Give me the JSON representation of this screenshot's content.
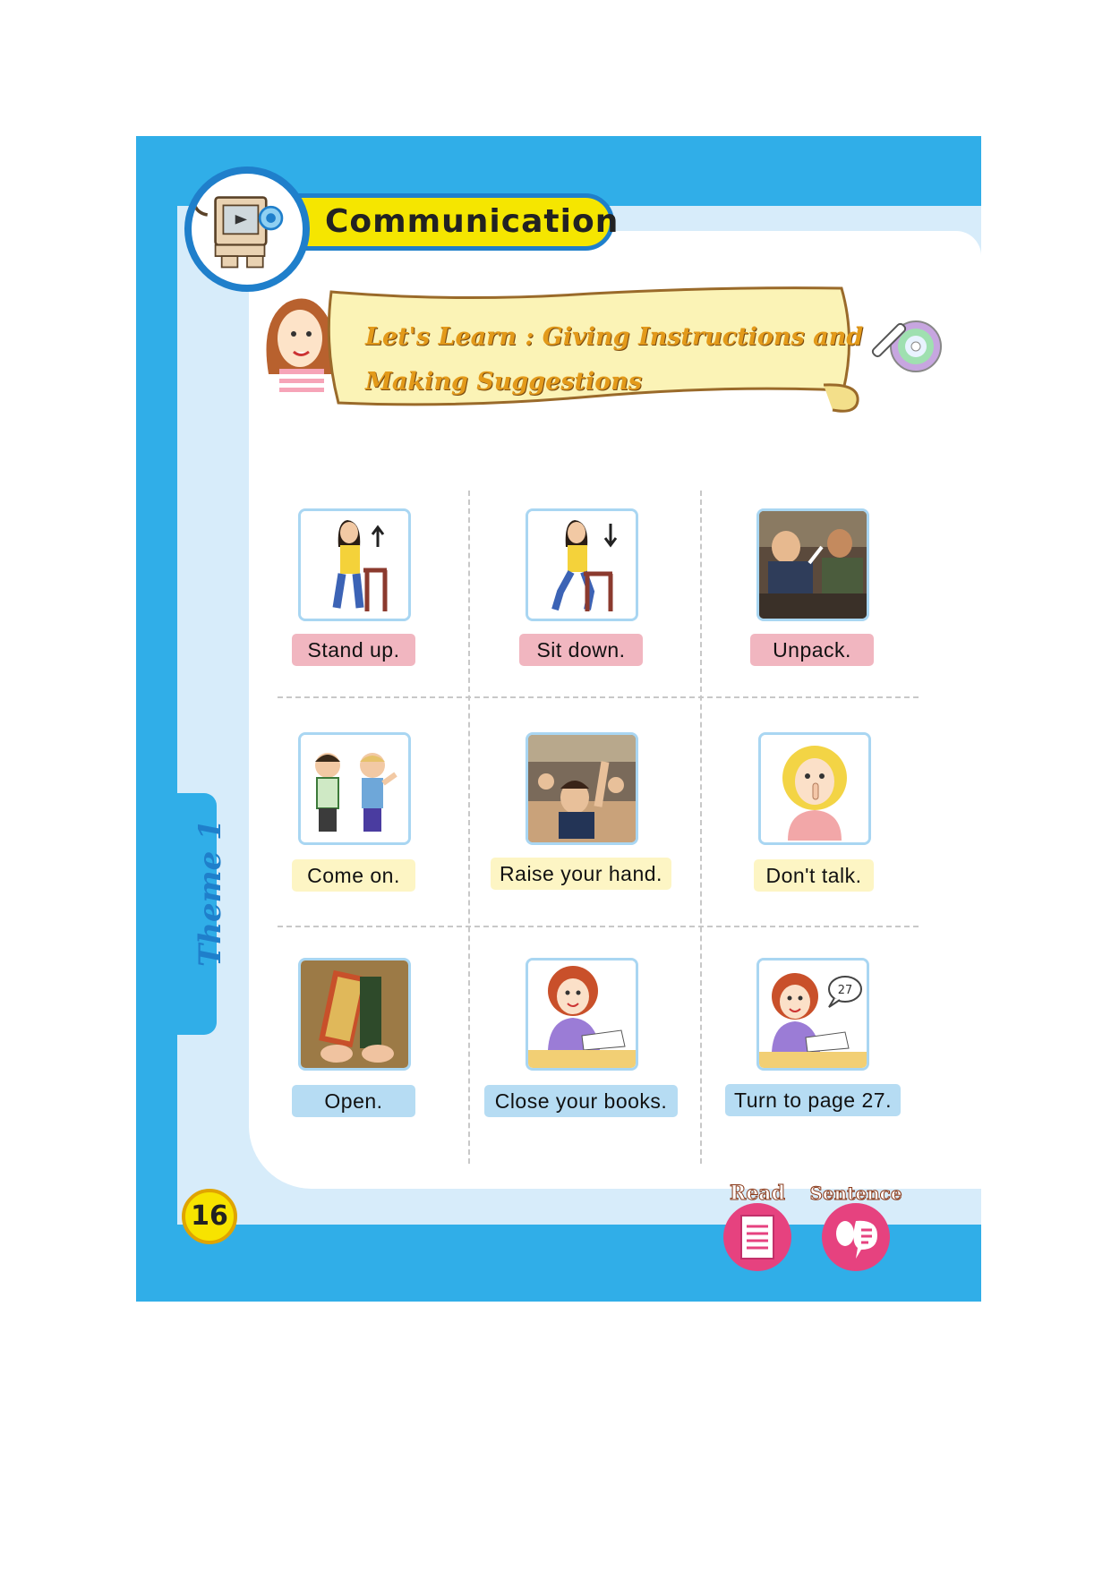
{
  "header": {
    "title": "Communication"
  },
  "banner": {
    "line1": "Let's Learn : Giving Instructions and",
    "line2": "Making Suggestions"
  },
  "side_tab": {
    "label": "Theme 1"
  },
  "page_number": "16",
  "items": [
    {
      "caption": "Stand up.",
      "color": "#f1b6c0",
      "icon": "girl-standing-up-picture"
    },
    {
      "caption": "Sit down.",
      "color": "#f1b6c0",
      "icon": "girl-sitting-down-picture"
    },
    {
      "caption": "Unpack.",
      "color": "#f1b6c0",
      "icon": "classroom-unpack-photo"
    },
    {
      "caption": "Come on.",
      "color": "#fdf5c4",
      "icon": "two-boys-picture"
    },
    {
      "caption": "Raise your hand.",
      "color": "#fdf5c4",
      "icon": "raise-hand-photo"
    },
    {
      "caption": "Don't talk.",
      "color": "#fdf5c4",
      "icon": "girl-finger-on-lips-picture"
    },
    {
      "caption": "Open.",
      "color": "#b6dcf3",
      "icon": "open-book-photo"
    },
    {
      "caption": "Close your books.",
      "color": "#b6dcf3",
      "icon": "girl-closing-book-picture"
    },
    {
      "caption": "Turn to page 27.",
      "color": "#b6dcf3",
      "icon": "girl-page-27-picture",
      "bubble": "27"
    }
  ],
  "footer_icons": {
    "read": "Read",
    "sentence": "Sentence"
  },
  "colors": {
    "frame_blue": "#30aee8",
    "light_blue": "#d7ecfa",
    "title_yellow": "#f5e600",
    "banner_orange": "#e39a1a"
  }
}
